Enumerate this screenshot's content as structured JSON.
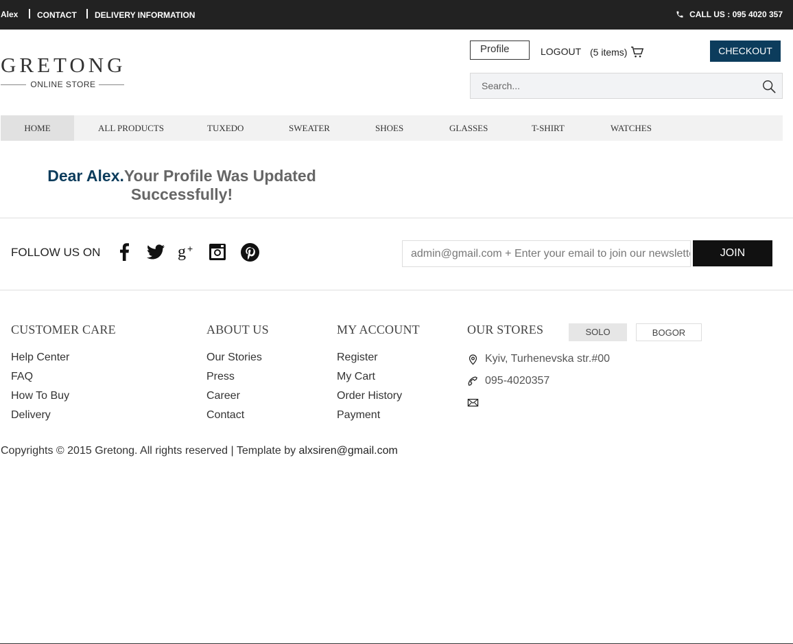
{
  "topbar": {
    "user": "Alex",
    "links": [
      "CONTACT",
      "DELIVERY INFORMATION"
    ],
    "call": "CALL US : 095 4020 357"
  },
  "logo": {
    "name": "GRETONG",
    "tagline": "ONLINE STORE"
  },
  "header": {
    "profile": "Profile",
    "logout": "LOGOUT",
    "cart": "(5 items)",
    "checkout": "CHECKOUT",
    "search_placeholder": "Search..."
  },
  "nav": {
    "items": [
      "HOME",
      "ALL PRODUCTS",
      "TUXEDO",
      "SWEATER",
      "SHOES",
      "GLASSES",
      "T-SHIRT",
      "WATCHES"
    ],
    "active": "HOME"
  },
  "message": {
    "dear": "Dear Alex.",
    "text": "Your Profile Was Updated Successfully!"
  },
  "follow": {
    "label": "FOLLOW US ON",
    "networks": [
      "facebook-icon",
      "twitter-icon",
      "google-plus-icon",
      "instagram-icon",
      "pinterest-icon"
    ],
    "newsletter_value": "admin@gmail.com + Enter your email to join our newsletter",
    "join": "JOIN"
  },
  "footer": {
    "customer_care": {
      "title": "CUSTOMER CARE",
      "links": [
        "Help Center",
        "FAQ",
        "How To Buy",
        "Delivery"
      ]
    },
    "about_us": {
      "title": "ABOUT US",
      "links": [
        "Our Stories",
        "Press",
        "Career",
        "Contact"
      ]
    },
    "my_account": {
      "title": "MY ACCOUNT",
      "links": [
        "Register",
        "My Cart",
        "Order History",
        "Payment"
      ]
    },
    "our_stores": {
      "title": "OUR STORES",
      "tabs": [
        "SOLO",
        "BOGOR"
      ],
      "address": "Kyiv, Turhenevska str.#00",
      "phone": "095-4020357"
    }
  },
  "copyright": {
    "text": "Copyrights © 2015 Gretong. All rights reserved | Template by ",
    "email": "alxsiren@gmail.com"
  },
  "colors": {
    "topbar": "#222222",
    "brand_blue": "#0c3c5c",
    "nav_bg": "#f2f2f2",
    "join_bg": "#111111"
  }
}
